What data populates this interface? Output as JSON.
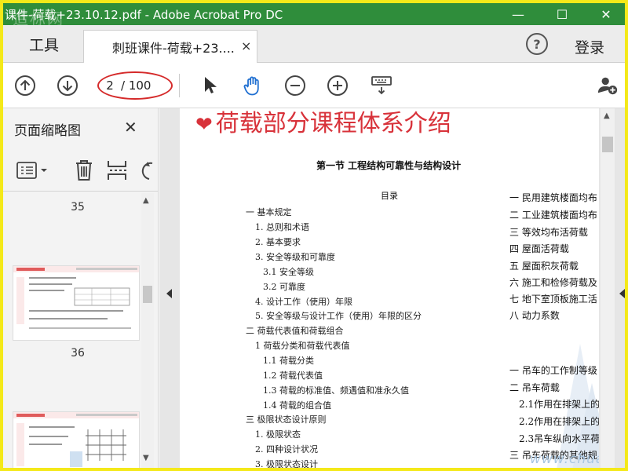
{
  "window": {
    "title": "课件-荷载+23.10.12.pdf - Adobe Acrobat Pro DC",
    "watermark": "造标网",
    "controls": [
      "—",
      "☐",
      "✕"
    ]
  },
  "tabs": {
    "tools_label": "工具",
    "doc_tab_label": "刺班课件-荷载+23....",
    "doc_tab_close": "×",
    "help": "?",
    "login": "登录"
  },
  "toolbar": {
    "current_page": "2",
    "page_total": "/ 100",
    "icons": [
      "arrow-up-circle-icon",
      "arrow-down-circle-icon",
      "pointer-icon",
      "hand-icon",
      "zoom-out-icon",
      "zoom-in-icon",
      "keyboard-icon",
      "add-user-icon"
    ],
    "accent": "#1f6fd1",
    "highlight_oval": "#d52a2a"
  },
  "sidebar": {
    "title": "页面缩略图",
    "close": "✕",
    "thumbnails": [
      {
        "number": "35"
      },
      {
        "number": "36"
      }
    ]
  },
  "page": {
    "header": "荷载部分课程体系介绍",
    "header_color": "#d8323a",
    "section_title": "第一节  工程结构可靠性与结构设计",
    "toc_title": "目录",
    "toc_left": [
      "一  基本规定",
      "1. 总则和术语",
      "2. 基本要求",
      "3. 安全等级和可靠度",
      "3.1  安全等级",
      "3.2  可靠度",
      "4. 设计工作（使用）年限",
      "5. 安全等级与设计工作（使用）年限的区分",
      "二  荷载代表值和荷载组合",
      "1  荷载分类和荷载代表值",
      "1.1  荷载分类",
      "1.2  荷载代表值",
      "1.3  荷载的标准值、频遇值和准永久值",
      "1.4  荷载的组合值",
      "三  极限状态设计原则",
      "1. 极限状态",
      "2. 四种设计状况",
      "3. 极限状态设计"
    ],
    "toc_right": [
      "一  民用建筑楼面均布",
      "二  工业建筑楼面均布",
      "三  等效均布活荷载",
      "四  屋面活荷载",
      "五  屋面积灰荷载",
      "六  施工和检修荷载及",
      "七  地下室顶板施工活",
      "八  动力系数",
      "一  吊车的工作制等级",
      "二  吊车荷载",
      "2.1作用在排架上的",
      "2.2作用在排架上的",
      "2.3吊车纵向水平荷",
      "三  吊车荷载的其他规"
    ],
    "site_mark": "www.chuaao.com"
  }
}
